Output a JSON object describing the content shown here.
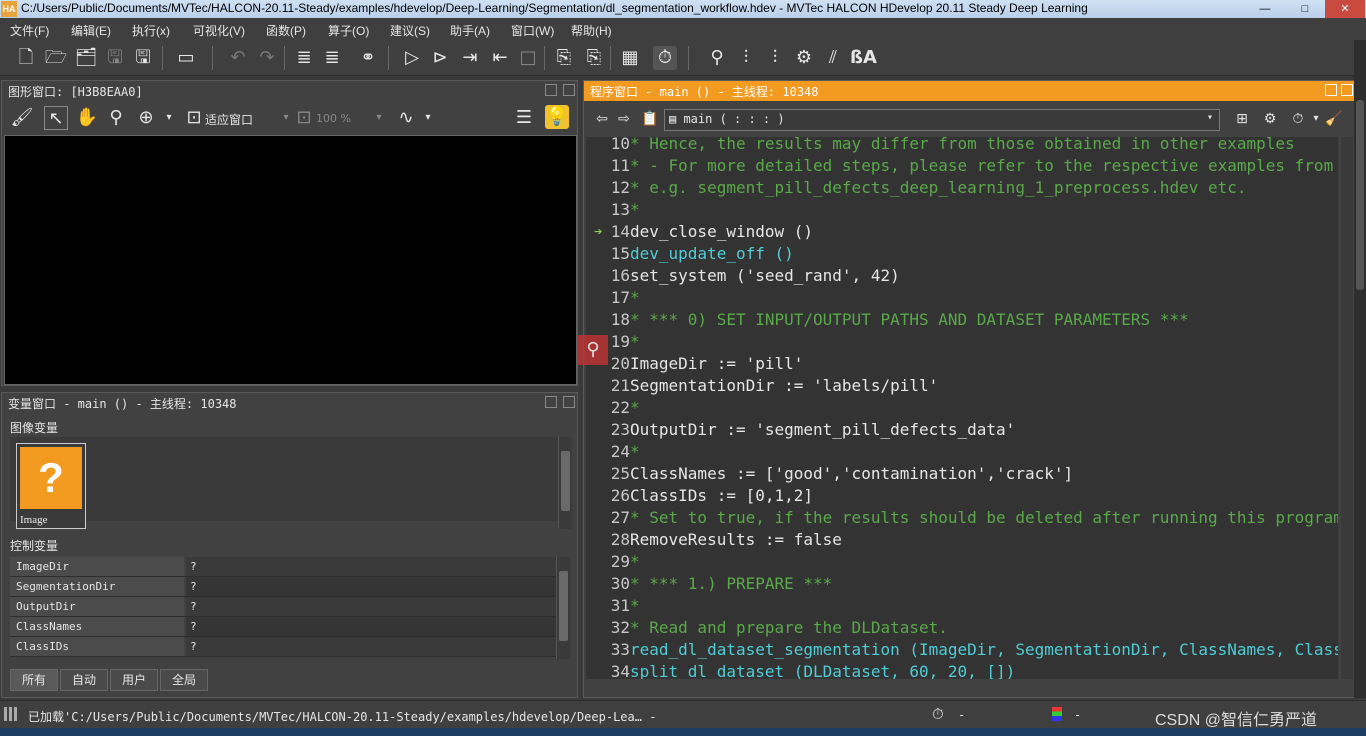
{
  "window": {
    "logo_text": "HA",
    "title": "C:/Users/Public/Documents/MVTec/HALCON-20.11-Steady/examples/hdevelop/Deep-Learning/Segmentation/dl_segmentation_workflow.hdev - MVTec HALCON HDevelop 20.11 Steady Deep Learning",
    "minimize": "—",
    "maximize": "□",
    "close": "✕"
  },
  "menu": [
    "文件(F)",
    "编辑(E)",
    "执行(x)",
    "可视化(V)",
    "函数(P)",
    "算子(O)",
    "建议(S)",
    "助手(A)",
    "窗口(W)",
    "帮助(H)"
  ],
  "toolbar_icons": [
    "new-file-icon",
    "open-file-icon",
    "open-example-icon",
    "save-icon",
    "save-all-icon",
    "record-icon",
    "undo-icon",
    "redo-icon",
    "insert-procedure-icon",
    "delete-procedure-icon",
    "binoculars-icon",
    "run-icon",
    "step-over-icon",
    "step-into-icon",
    "step-out-icon",
    "stop-icon",
    "reset-program-icon",
    "reset-all-icon",
    "set-breakpoint-icon",
    "profiler-icon",
    "zoom-icon",
    "histogram-icon",
    "line-profile-icon",
    "gray-value-icon",
    "feature-histogram-icon",
    "ocr-icon"
  ],
  "graphics_window": {
    "title": "图形窗口: [H3B8EAA0]",
    "fit_label": "适应窗口",
    "zoom_value": "100 %"
  },
  "variables_window": {
    "title": "变量窗口 - main () - 主线程: 10348",
    "iconic_label": "图像变量",
    "image_var_name": "Image",
    "image_var_glyph": "?",
    "control_label": "控制变量",
    "control_vars": [
      {
        "name": "ImageDir",
        "value": "?"
      },
      {
        "name": "SegmentationDir",
        "value": "?"
      },
      {
        "name": "OutputDir",
        "value": "?"
      },
      {
        "name": "ClassNames",
        "value": "?"
      },
      {
        "name": "ClassIDs",
        "value": "?"
      }
    ],
    "tabs": [
      "所有",
      "自动",
      "用户",
      "全局"
    ]
  },
  "program_window": {
    "title": "程序窗口 - main () - 主线程: 10348",
    "procedure": "main ( : : : )",
    "lines": [
      {
        "n": "10",
        "text": "*   Hence, the results may differ from those obtained in other examples",
        "kind": "comment"
      },
      {
        "n": "11",
        "text": "* - For more detailed steps, please refer to the respective examples from",
        "kind": "comment"
      },
      {
        "n": "12",
        "text": "*   e.g. segment_pill_defects_deep_learning_1_preprocess.hdev etc.",
        "kind": "comment"
      },
      {
        "n": "13",
        "text": "*",
        "kind": "comment"
      },
      {
        "n": "14",
        "text": "dev_close_window ()",
        "kind": "code"
      },
      {
        "n": "15",
        "text": "dev_update_off ()",
        "kind": "op"
      },
      {
        "n": "16",
        "text": "set_system ('seed_rand', 42)",
        "kind": "code"
      },
      {
        "n": "17",
        "text": "*",
        "kind": "comment"
      },
      {
        "n": "18",
        "text": "* ***   0) SET INPUT/OUTPUT PATHS AND DATASET PARAMETERS   ***",
        "kind": "comment"
      },
      {
        "n": "19",
        "text": "*",
        "kind": "comment"
      },
      {
        "n": "20",
        "text": "ImageDir := 'pill'",
        "kind": "code"
      },
      {
        "n": "21",
        "text": "SegmentationDir := 'labels/pill'",
        "kind": "code"
      },
      {
        "n": "22",
        "text": "*",
        "kind": "comment"
      },
      {
        "n": "23",
        "text": "OutputDir := 'segment_pill_defects_data'",
        "kind": "code"
      },
      {
        "n": "24",
        "text": "*",
        "kind": "comment"
      },
      {
        "n": "25",
        "text": "ClassNames := ['good','contamination','crack']",
        "kind": "code"
      },
      {
        "n": "26",
        "text": "ClassIDs := [0,1,2]",
        "kind": "code"
      },
      {
        "n": "27",
        "text": "* Set to true, if the results should be deleted after running this program",
        "kind": "comment"
      },
      {
        "n": "28",
        "text": "RemoveResults := false",
        "kind": "code"
      },
      {
        "n": "29",
        "text": "*",
        "kind": "comment"
      },
      {
        "n": "30",
        "text": "* ***   1.) PREPARE   ***",
        "kind": "comment"
      },
      {
        "n": "31",
        "text": "*",
        "kind": "comment"
      },
      {
        "n": "32",
        "text": "* Read and prepare the DLDataset.",
        "kind": "comment"
      },
      {
        "n": "33",
        "text": "read_dl_dataset_segmentation (ImageDir, SegmentationDir, ClassNames, ClassIDs",
        "kind": "op"
      },
      {
        "n": "34",
        "text": "split_dl_dataset (DLDataset, 60, 20, [])",
        "kind": "op"
      }
    ]
  },
  "statusbar": {
    "loaded_text": "已加载'C:/Users/Public/Documents/MVTec/HALCON-20.11-Steady/examples/hdevelop/Deep-Lea…  -",
    "timer_value": "-",
    "color_value": "-",
    "watermark": "CSDN @智信仁勇严道"
  }
}
